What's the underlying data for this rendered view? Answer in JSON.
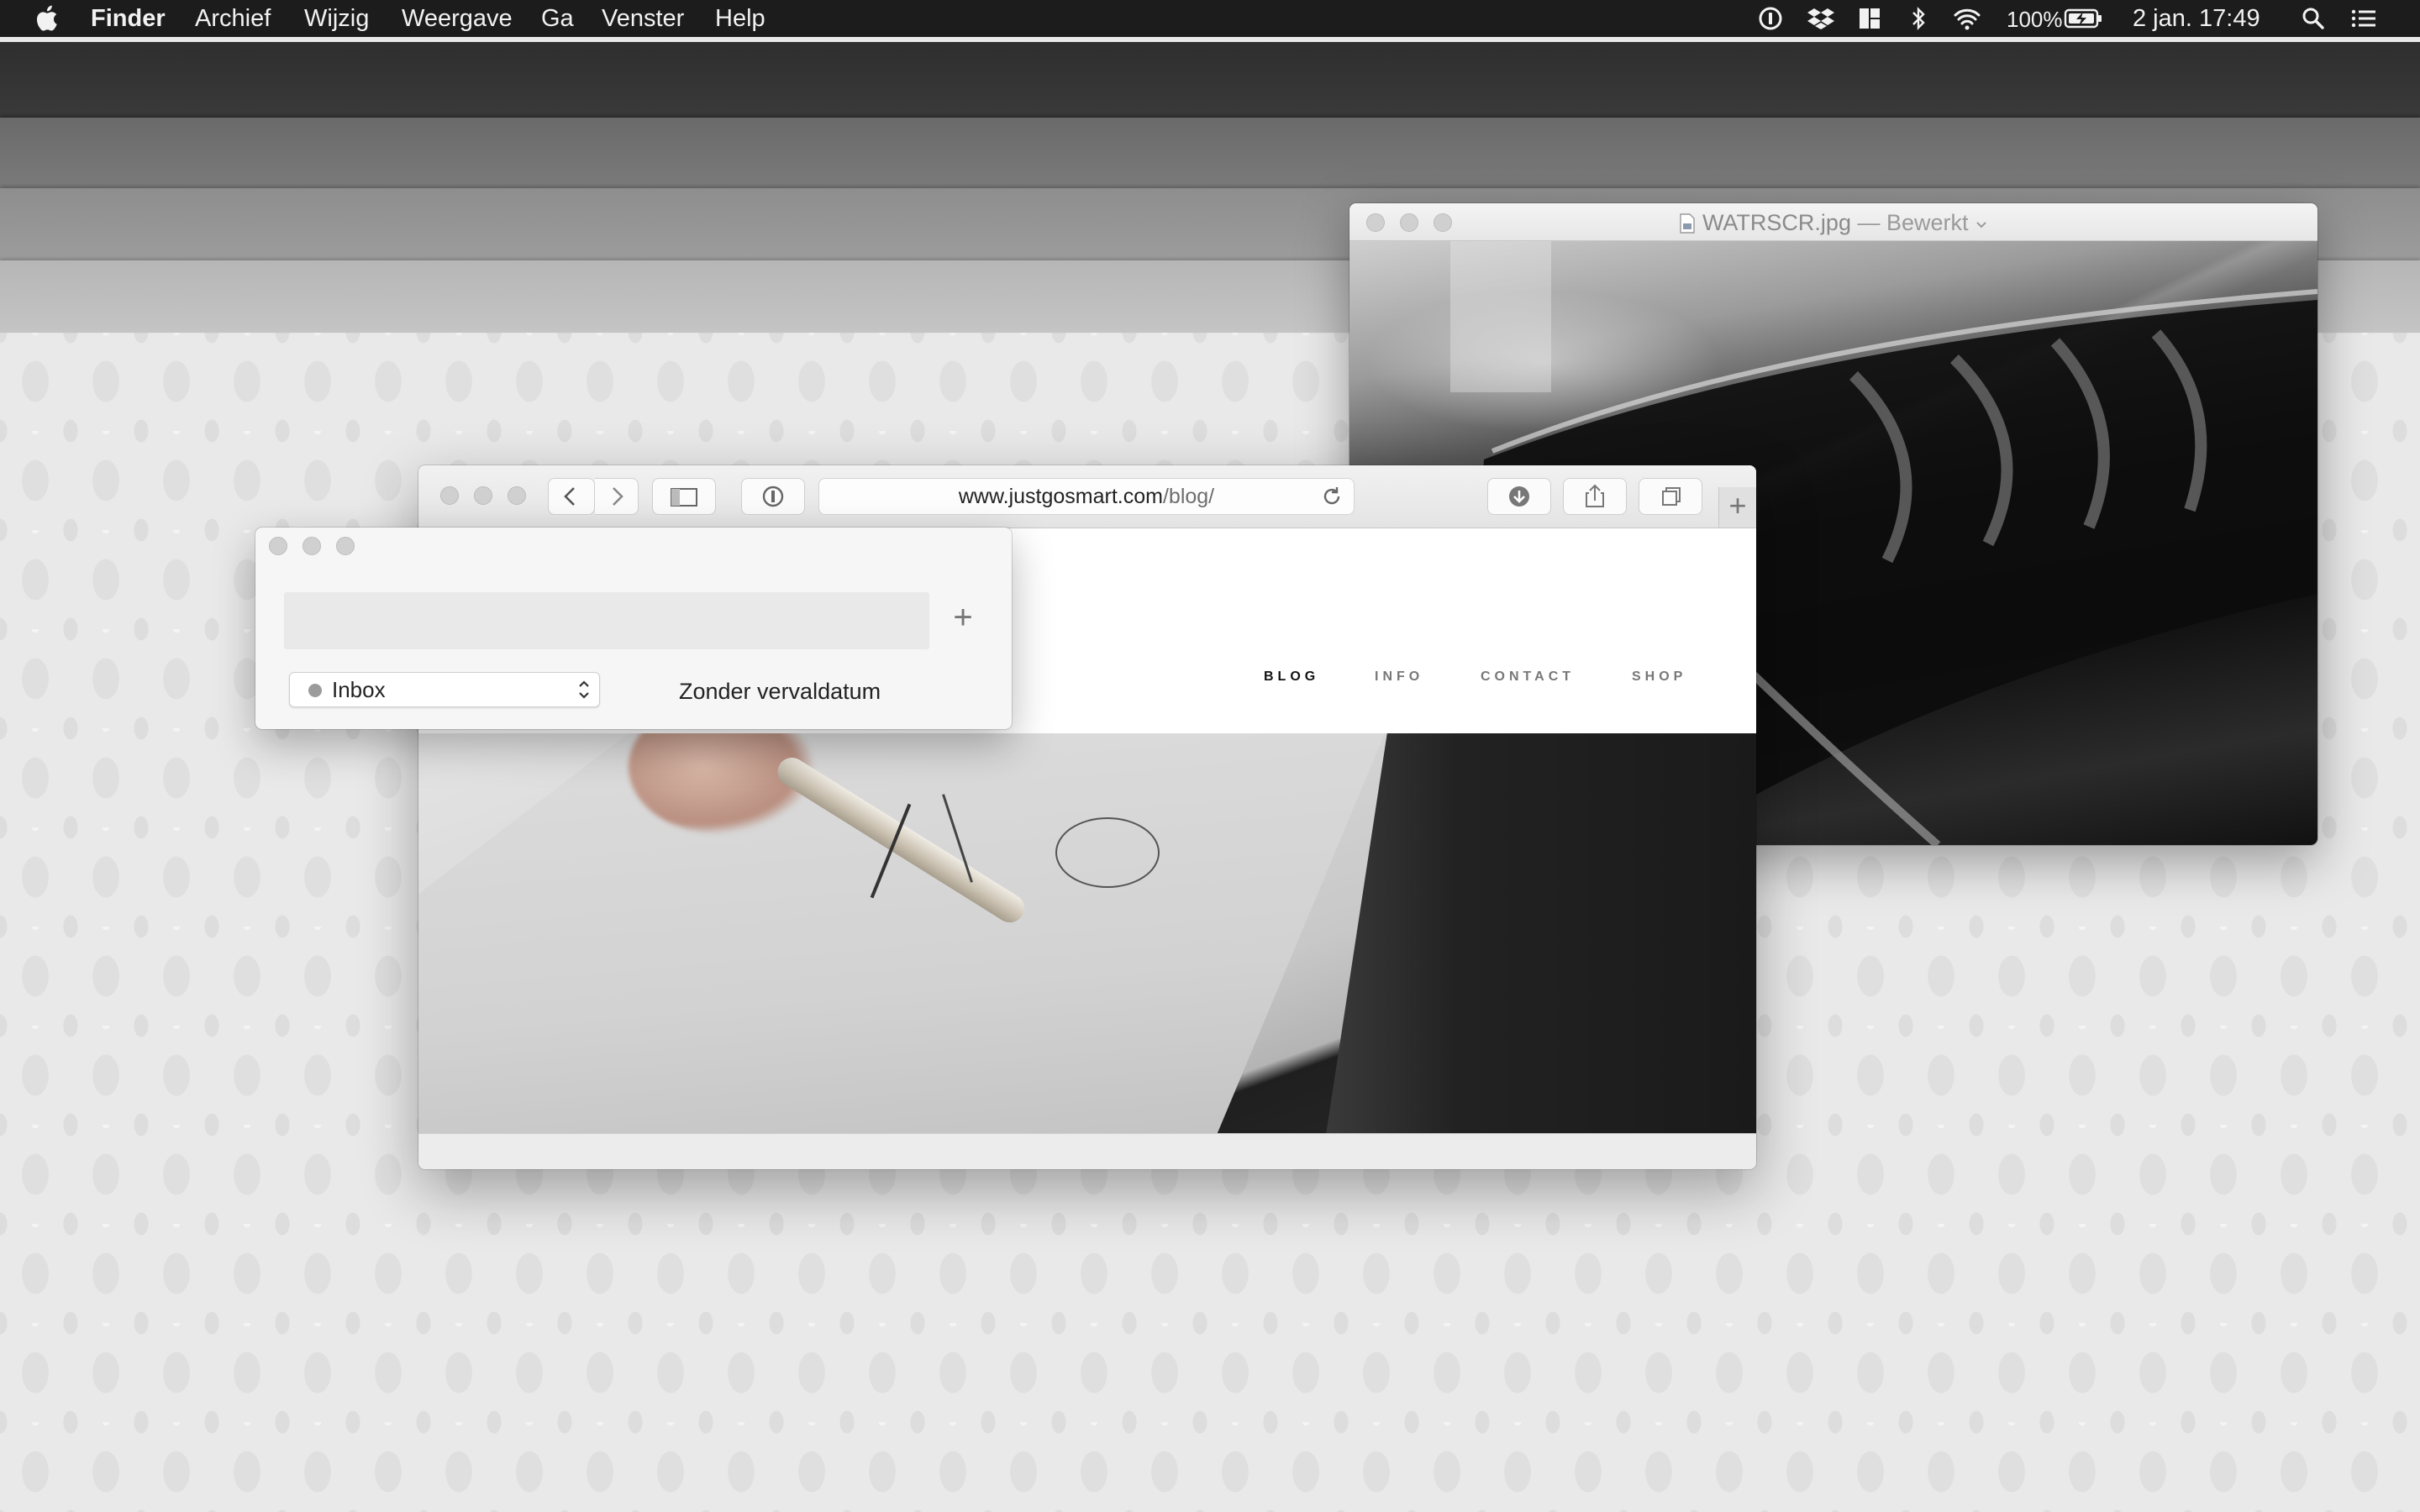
{
  "menubar": {
    "app": "Finder",
    "items": [
      "Archief",
      "Wijzig",
      "Weergave",
      "Ga",
      "Venster",
      "Help"
    ],
    "battery": "100%",
    "clock": "2 jan. 17:49",
    "status_icons": [
      "1password-icon",
      "dropbox-icon",
      "layout-icon",
      "bluetooth-icon",
      "wifi-icon",
      "battery-charging-icon",
      "spotlight-search-icon",
      "notification-list-icon"
    ]
  },
  "preview": {
    "filename": "WATRSCR.jpg",
    "state": "— Bewerkt"
  },
  "safari": {
    "url_host": "www.justgosmart.com",
    "url_path": "/blog/",
    "new_tab": "+",
    "nav": [
      {
        "label": "BLOG",
        "active": true
      },
      {
        "label": "INFO",
        "active": false
      },
      {
        "label": "CONTACT",
        "active": false
      },
      {
        "label": "SHOP",
        "active": false
      }
    ]
  },
  "reminder": {
    "input_value": "",
    "add_label": "+",
    "list": "Inbox",
    "list_color": "#9b9b9b",
    "due": "Zonder vervaldatum"
  }
}
